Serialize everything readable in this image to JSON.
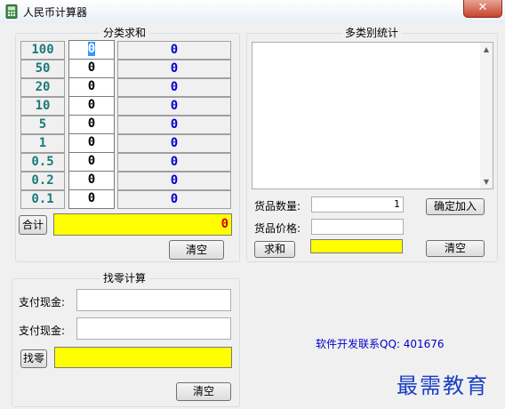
{
  "window": {
    "title": "人民币计算器",
    "close": "✕"
  },
  "groups": {
    "sum": "分类求和",
    "multi": "多类别统计",
    "change": "找零计算"
  },
  "denominations": [
    {
      "label": "100",
      "count": "0",
      "result": "0"
    },
    {
      "label": "50",
      "count": "0",
      "result": "0"
    },
    {
      "label": "20",
      "count": "0",
      "result": "0"
    },
    {
      "label": "10",
      "count": "0",
      "result": "0"
    },
    {
      "label": "5",
      "count": "0",
      "result": "0"
    },
    {
      "label": "1",
      "count": "0",
      "result": "0"
    },
    {
      "label": "0.5",
      "count": "0",
      "result": "0"
    },
    {
      "label": "0.2",
      "count": "0",
      "result": "0"
    },
    {
      "label": "0.1",
      "count": "0",
      "result": "0"
    }
  ],
  "sum": {
    "total_button": "合计",
    "total_value": "0",
    "clear_button": "清空"
  },
  "multi": {
    "qty_label": "货品数量:",
    "qty_value": "1",
    "price_label": "货品价格:",
    "price_value": "",
    "confirm_button": "确定加入",
    "sum_button": "求和",
    "sum_value": "",
    "clear_button": "清空"
  },
  "change": {
    "pay1_label": "支付现金:",
    "pay1_value": "",
    "pay2_label": "支付现金:",
    "pay2_value": "",
    "change_button": "找零",
    "change_value": "",
    "clear_button": "清空"
  },
  "footer": {
    "contact": "软件开发联系QQ: 401676",
    "watermark": "最需教育"
  },
  "colors": {
    "highlight": "#ffff00",
    "result_text": "#0000cc",
    "denom_text": "#1b7a7a"
  }
}
